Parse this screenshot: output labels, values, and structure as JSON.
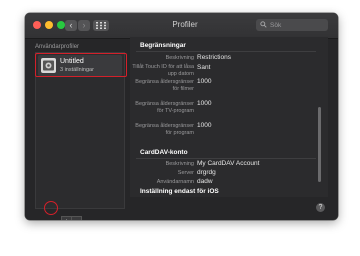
{
  "window": {
    "title": "Profiler"
  },
  "toolbar": {
    "back_icon": "chevron-left-icon",
    "forward_icon": "chevron-right-icon",
    "grid_icon": "grid-icon",
    "back_glyph": "‹",
    "forward_glyph": "›"
  },
  "search": {
    "placeholder": "Sök",
    "value": "",
    "icon": "search-icon"
  },
  "sidebar": {
    "label": "Användarprofiler",
    "items": [
      {
        "name": "Untitled",
        "subtitle": "3 inställningar",
        "icon": "profile-icon",
        "selected": true
      }
    ]
  },
  "footer": {
    "add_label": "+",
    "remove_label": "−",
    "help_label": "?"
  },
  "details": {
    "restrictions": {
      "title": "Begränsningar",
      "rows": [
        {
          "key": "Beskrivning",
          "value": "Restrictions"
        },
        {
          "key": "Tillåt Touch ID för att låsa upp datorn",
          "value": "Sant"
        },
        {
          "key": "Begränsa åldersgränser för filmer",
          "value": "1000"
        },
        {
          "key": "Begränsa åldersgränser för TV-program",
          "value": "1000"
        },
        {
          "key": "Begränsa åldersgränser för program",
          "value": "1000"
        }
      ]
    },
    "carddav": {
      "title": "CardDAV-konto",
      "rows": [
        {
          "key": "Beskrivning",
          "value": "My CardDAV Account"
        },
        {
          "key": "Server",
          "value": "drgrdg"
        },
        {
          "key": "Användarnamn",
          "value": "dadw"
        }
      ]
    },
    "ios_section": {
      "title": "Inställning endast för iOS"
    }
  },
  "colors": {
    "window_bg": "#262628",
    "highlight_red": "#d4202a",
    "traffic_red": "#fe5f57",
    "traffic_yellow": "#febc2e",
    "traffic_green": "#28c840"
  }
}
